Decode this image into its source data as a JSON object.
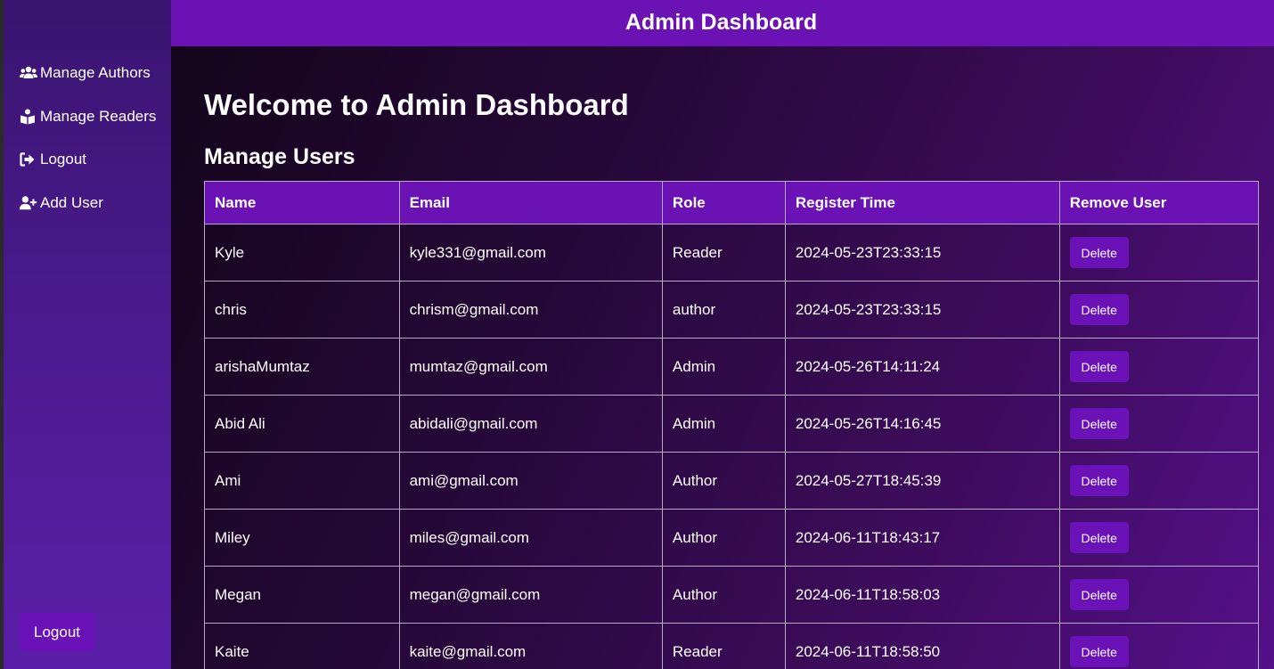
{
  "header": {
    "title": "Admin Dashboard"
  },
  "sidebar": {
    "items": [
      {
        "label": "Manage Authors",
        "icon": "users-icon"
      },
      {
        "label": "Manage Readers",
        "icon": "book-reader-icon"
      },
      {
        "label": "Logout",
        "icon": "sign-out-icon"
      },
      {
        "label": "Add User",
        "icon": "user-plus-icon"
      }
    ],
    "logout_button": "Logout"
  },
  "main": {
    "title": "Welcome to Admin Dashboard",
    "section_title": "Manage Users",
    "table": {
      "headers": [
        "Name",
        "Email",
        "Role",
        "Register Time",
        "Remove User"
      ],
      "rows": [
        {
          "name": "Kyle",
          "email": "kyle331@gmail.com",
          "role": "Reader",
          "time": "2024-05-23T23:33:15",
          "action": "Delete"
        },
        {
          "name": "chris",
          "email": "chrism@gmail.com",
          "role": "author",
          "time": "2024-05-23T23:33:15",
          "action": "Delete"
        },
        {
          "name": "arishaMumtaz",
          "email": "mumtaz@gmail.com",
          "role": "Admin",
          "time": "2024-05-26T14:11:24",
          "action": "Delete"
        },
        {
          "name": "Abid Ali",
          "email": "abidali@gmail.com",
          "role": "Admin",
          "time": "2024-05-26T14:16:45",
          "action": "Delete"
        },
        {
          "name": "Ami",
          "email": "ami@gmail.com",
          "role": "Author",
          "time": "2024-05-27T18:45:39",
          "action": "Delete"
        },
        {
          "name": "Miley",
          "email": "miles@gmail.com",
          "role": "Author",
          "time": "2024-06-11T18:43:17",
          "action": "Delete"
        },
        {
          "name": "Megan",
          "email": "megan@gmail.com",
          "role": "Author",
          "time": "2024-06-11T18:58:03",
          "action": "Delete"
        },
        {
          "name": "Kaite",
          "email": "kaite@gmail.com",
          "role": "Reader",
          "time": "2024-06-11T18:58:50",
          "action": "Delete"
        }
      ]
    }
  },
  "colors": {
    "accent": "#6a12b4",
    "sidebar": "#4a1a8c",
    "text": "#ffffff"
  }
}
